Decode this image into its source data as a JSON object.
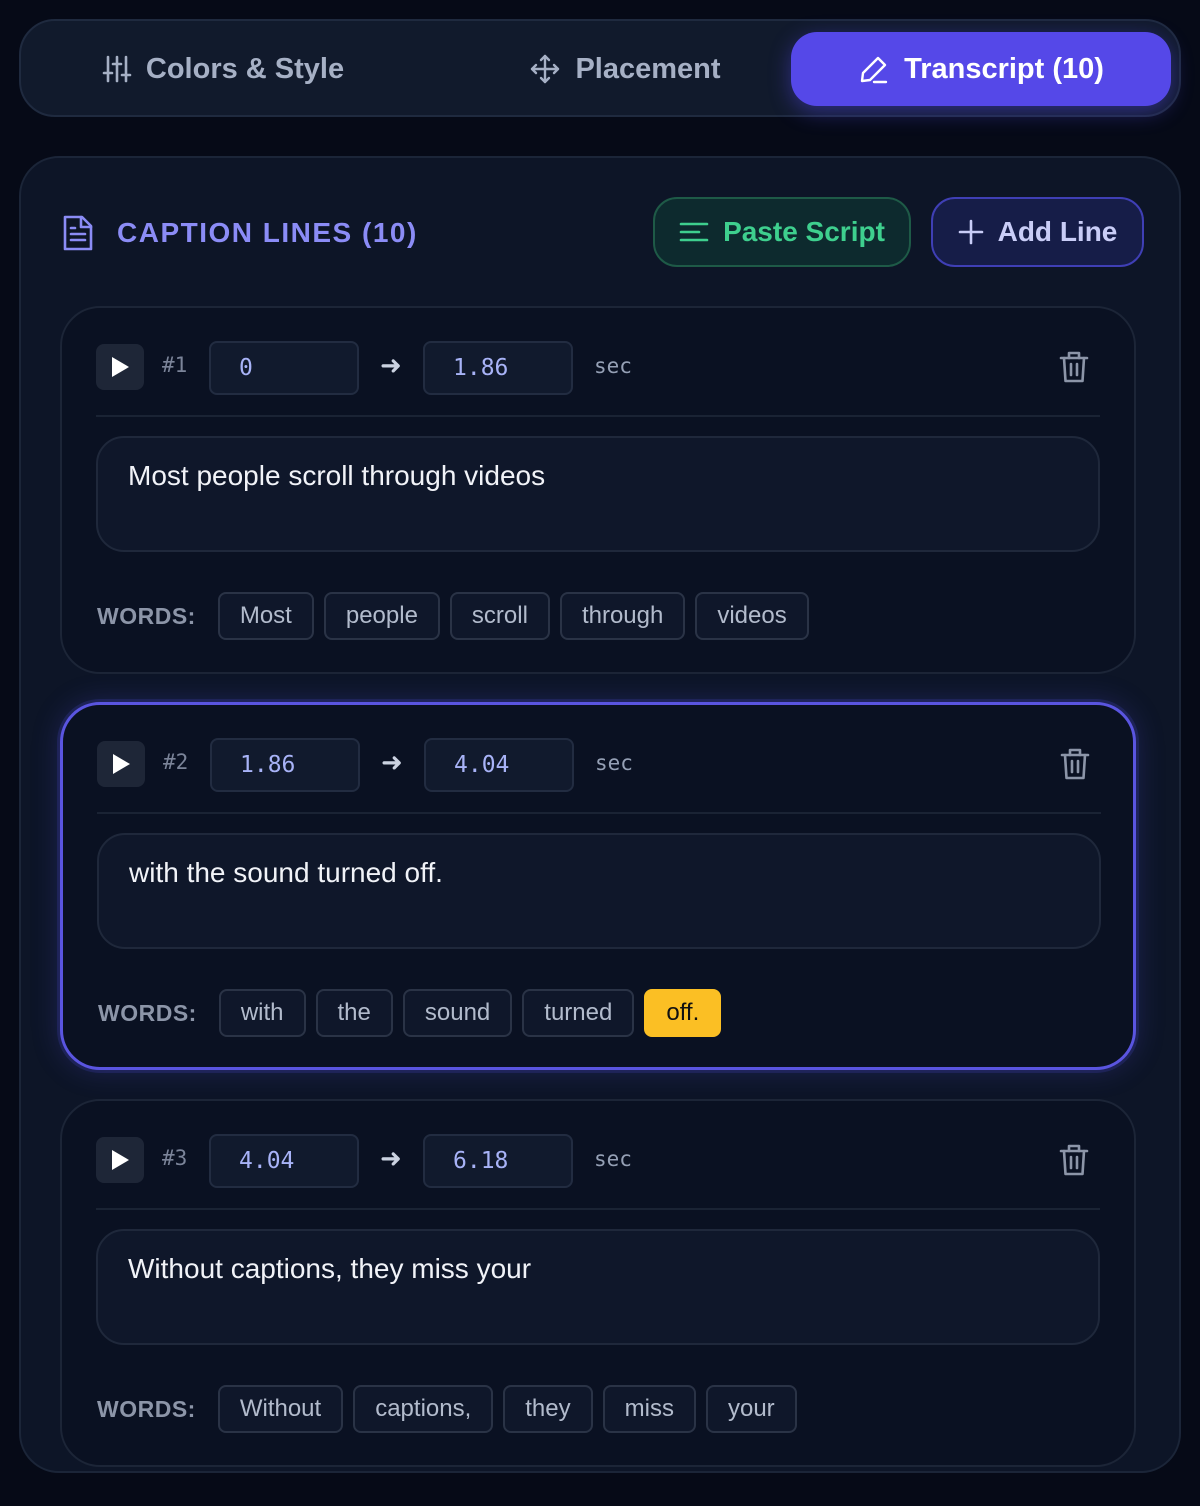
{
  "tabs": [
    {
      "label": "Colors & Style",
      "icon": "sliders-icon"
    },
    {
      "label": "Placement",
      "icon": "move-icon"
    },
    {
      "label": "Transcript (10)",
      "icon": "pencil-icon",
      "active": true
    }
  ],
  "panel": {
    "title": "CAPTION LINES (10)",
    "paste_label": "Paste Script",
    "add_label": "Add Line"
  },
  "labels": {
    "sec": "sec",
    "words": "WORDS:",
    "arrow": "➜"
  },
  "lines": [
    {
      "num": "#1",
      "start": "0",
      "end": "1.86",
      "text": "Most people scroll through videos",
      "words": [
        "Most",
        "people",
        "scroll",
        "through",
        "videos"
      ],
      "highlighted_word": null,
      "selected": false
    },
    {
      "num": "#2",
      "start": "1.86",
      "end": "4.04",
      "text": "with the sound turned off.",
      "words": [
        "with",
        "the",
        "sound",
        "turned",
        "off."
      ],
      "highlighted_word": 4,
      "selected": true
    },
    {
      "num": "#3",
      "start": "4.04",
      "end": "6.18",
      "text": "Without captions, they miss your",
      "words": [
        "Without",
        "captions,",
        "they",
        "miss",
        "your"
      ],
      "highlighted_word": null,
      "selected": false
    }
  ],
  "colors": {
    "accent": "#5548e8",
    "paste_green": "#3ecf8e",
    "highlight": "#fbbf24",
    "title_purple": "#8b8cf6"
  }
}
